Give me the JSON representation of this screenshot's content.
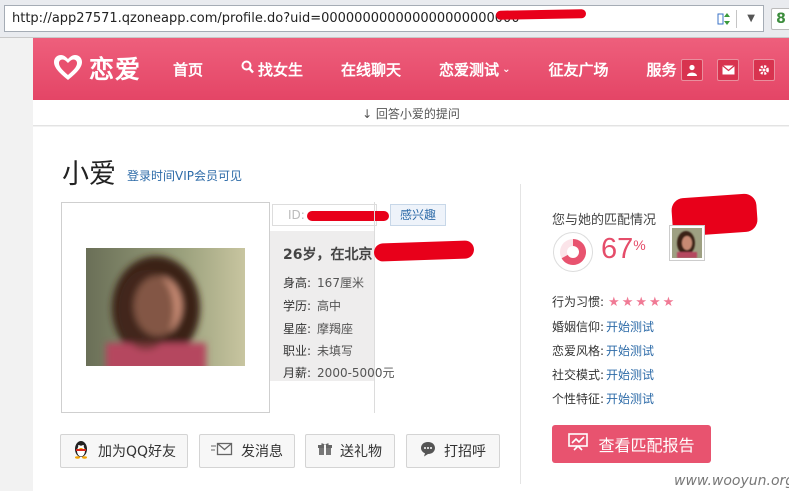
{
  "browser": {
    "url": "http://app27571.qzoneapp.com/profile.do?uid=000000000000000000000000"
  },
  "site": {
    "logo_text": "恋爱",
    "nav": [
      {
        "label": "首页"
      },
      {
        "label": "找女生"
      },
      {
        "label": "在线聊天"
      },
      {
        "label": "恋爱测试"
      },
      {
        "label": "征友广场"
      },
      {
        "label": "服务"
      }
    ]
  },
  "subbar": {
    "text": "↓ 回答小爱的提问"
  },
  "profile": {
    "name": "小爱",
    "vip_hint": "登录时间VIP会员可见",
    "id_label": "ID:",
    "interest_label": "感兴趣",
    "headline": "26岁，在北京",
    "details": [
      {
        "key": "身高:",
        "value": "167厘米"
      },
      {
        "key": "学历:",
        "value": "高中"
      },
      {
        "key": "星座:",
        "value": "摩羯座"
      },
      {
        "key": "职业:",
        "value": "未填写"
      },
      {
        "key": "月薪:",
        "value": "2000-5000元"
      }
    ],
    "actions": [
      {
        "label": "加为QQ好友"
      },
      {
        "label": "发消息"
      },
      {
        "label": "送礼物"
      },
      {
        "label": "打招呼"
      }
    ]
  },
  "match": {
    "label": "您与她的匹配情况",
    "percent_number": "67",
    "percent_sign": "%",
    "percent_value": 67,
    "behavior_label": "行为习惯:",
    "behavior_stars": "★★★★★",
    "traits": [
      {
        "key": "婚姻信仰:",
        "link": "开始测试"
      },
      {
        "key": "恋爱风格:",
        "link": "开始测试"
      },
      {
        "key": "社交模式:",
        "link": "开始测试"
      },
      {
        "key": "个性特征:",
        "link": "开始测试"
      }
    ],
    "report_button": "查看匹配报告"
  },
  "watermark": "www.wooyun.org",
  "colors": {
    "brand_pink": "#e9506e",
    "link_blue": "#2d6ba8",
    "redaction_red": "#e8001a"
  }
}
